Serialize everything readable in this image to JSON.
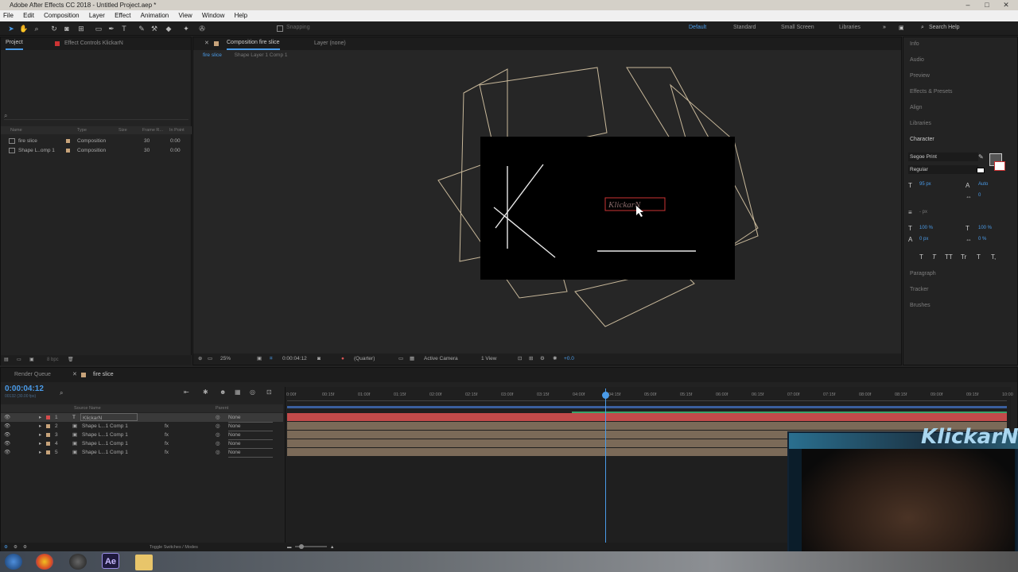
{
  "app": {
    "title": "Adobe After Effects CC 2018 - Untitled Project.aep *"
  },
  "menu": [
    "File",
    "Edit",
    "Composition",
    "Layer",
    "Effect",
    "Animation",
    "View",
    "Window",
    "Help"
  ],
  "toolbar": {
    "snapping": "Snapping",
    "workspaces": [
      "Default",
      "Standard",
      "Small Screen",
      "Libraries"
    ],
    "search": "Search Help"
  },
  "project_panel": {
    "tabs": [
      "Project",
      "Effect Controls KlickarN"
    ],
    "columns": [
      "Name",
      "Type",
      "Size",
      "Frame R...",
      "In Point"
    ],
    "items": [
      {
        "name": "fire slice",
        "type": "Composition",
        "frame": "30",
        "in": "0:00"
      },
      {
        "name": "Shape L..omp 1",
        "type": "Composition",
        "frame": "30",
        "in": "0:00"
      }
    ],
    "bpc": "8 bpc"
  },
  "composition": {
    "tab": "Composition fire slice",
    "layer_tab": "Layer (none)",
    "breadcrumbs": [
      "fire slice",
      "Shape Layer 1 Comp 1"
    ],
    "text_layer": "KlickarN"
  },
  "viewer_bar": {
    "zoom": "25%",
    "timecode": "0:00:04:12",
    "resolution": "(Quarter)",
    "camera": "Active Camera",
    "views": "1 View",
    "exposure": "+0.0"
  },
  "right_panel": {
    "items": [
      "Info",
      "Audio",
      "Preview",
      "Effects & Presets",
      "Align",
      "Libraries",
      "Character"
    ],
    "font": "Segoe Print",
    "style": "Regular",
    "char_values": {
      "size": "95 px",
      "leading": "Auto",
      "tracking": "0",
      "stroke": "- px",
      "vscale": "100 %",
      "hscale": "100 %",
      "baseline": "0 px",
      "tsume": "0 %"
    },
    "lower_items": [
      "Paragraph",
      "Tracker",
      "Brushes"
    ],
    "text_styles": [
      "T",
      "T",
      "TT",
      "Tr",
      "T",
      "T,"
    ]
  },
  "timeline": {
    "tabs": [
      "Render Queue",
      "fire slice"
    ],
    "timecode": "0:00:04:12",
    "fps_label": "00132 (30.00 fps)",
    "columns": [
      "Source Name",
      "Parent"
    ],
    "layers": [
      {
        "num": "1",
        "name": "KlickarN",
        "parent": "None"
      },
      {
        "num": "2",
        "name": "Shape L...1 Comp 1",
        "parent": "None"
      },
      {
        "num": "3",
        "name": "Shape L...1 Comp 1",
        "parent": "None"
      },
      {
        "num": "4",
        "name": "Shape L...1 Comp 1",
        "parent": "None"
      },
      {
        "num": "5",
        "name": "Shape L...1 Comp 1",
        "parent": "None"
      }
    ],
    "ruler": [
      "0:00f",
      "00:15f",
      "01:00f",
      "01:15f",
      "02:00f",
      "02:15f",
      "03:00f",
      "03:15f",
      "04:00f",
      "04:15f",
      "05:00f",
      "05:15f",
      "06:00f",
      "06:15f",
      "07:00f",
      "07:15f",
      "08:00f",
      "08:15f",
      "09:00f",
      "09:15f",
      "10:00"
    ],
    "toggle_label": "Toggle Switches / Modes"
  },
  "webcam": {
    "overlay_text": "KlickarN"
  }
}
